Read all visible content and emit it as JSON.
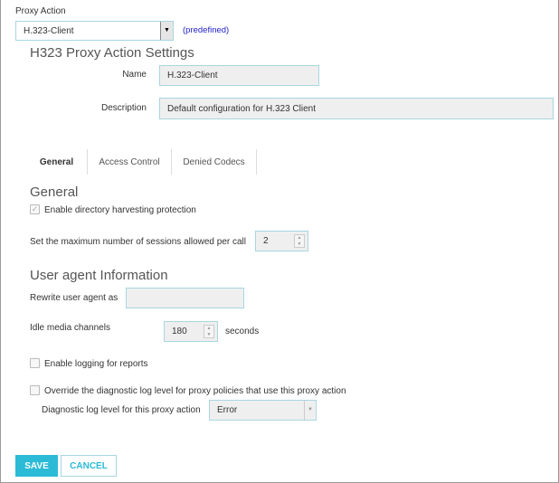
{
  "proxy_action": {
    "label": "Proxy Action",
    "value": "H.323-Client",
    "note": "(predefined)"
  },
  "settings": {
    "title": "H323 Proxy Action Settings",
    "name_label": "Name",
    "name_value": "H.323-Client",
    "description_label": "Description",
    "description_value": "Default configuration for H.323 Client"
  },
  "tabs": [
    {
      "label": "General",
      "active": true
    },
    {
      "label": "Access Control"
    },
    {
      "label": "Denied Codecs"
    }
  ],
  "general": {
    "heading": "General",
    "harvest_label": "Enable directory harvesting protection",
    "harvest_checked": true,
    "sessions_label": "Set the maximum number of sessions allowed per call",
    "sessions_value": "2"
  },
  "user_agent": {
    "heading": "User agent Information",
    "rewrite_label": "Rewrite user agent as",
    "rewrite_value": "",
    "idle_label": "Idle media channels",
    "idle_value": "180",
    "idle_unit": "seconds"
  },
  "logging": {
    "label": "Enable logging for reports",
    "checked": false
  },
  "diagnostic": {
    "override_label": "Override the diagnostic log level for proxy policies that use this proxy action",
    "override_checked": false,
    "level_label": "Diagnostic log level for this proxy action",
    "level_value": "Error"
  },
  "buttons": {
    "save": "SAVE",
    "cancel": "CANCEL"
  },
  "colors": {
    "accent": "#2bbbd6",
    "link": "#2222cc"
  }
}
